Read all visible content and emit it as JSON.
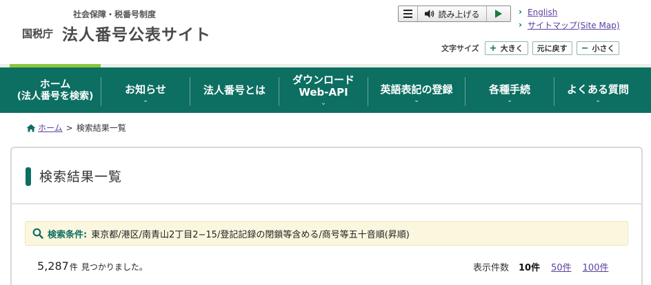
{
  "header": {
    "logo_sub": "社会保障・税番号制度",
    "logo_agency": "国税庁",
    "logo_main": "法人番号公表サイト",
    "readspeaker": {
      "read_label": "読み上げる",
      "menu_icon": "menu-icon",
      "speaker_icon": "speaker-icon",
      "play_icon": "play-icon"
    },
    "links": [
      {
        "label": "English"
      },
      {
        "label": "サイトマップ(Site Map)"
      }
    ],
    "font_size": {
      "label": "文字サイズ",
      "larger": "大きく",
      "larger_mark": "+",
      "reset": "元に戻す",
      "smaller": "小さく",
      "smaller_mark": "−"
    }
  },
  "nav": [
    {
      "line1": "ホーム",
      "line2": "(法人番号を検索)",
      "chevron": false
    },
    {
      "line1": "お知らせ",
      "line2": "",
      "chevron": true
    },
    {
      "line1": "法人番号とは",
      "line2": "",
      "chevron": false
    },
    {
      "line1": "ダウンロード",
      "line2": "Web-API",
      "chevron": true
    },
    {
      "line1": "英語表記の登録",
      "line2": "",
      "chevron": true
    },
    {
      "line1": "各種手続",
      "line2": "",
      "chevron": true
    },
    {
      "line1": "よくある質問",
      "line2": "",
      "chevron": true
    }
  ],
  "breadcrumb": {
    "home": "ホーム",
    "separator": ">",
    "current": "検索結果一覧"
  },
  "main": {
    "title": "検索結果一覧",
    "search_condition_label": "検索条件:",
    "search_condition_value": "東京都/港区/南青山2丁目2−15/登記記録の閉鎖等含める/商号等五十音順(昇順)",
    "result_count": "5,287",
    "result_unit": "件",
    "result_message": "見つかりました。",
    "per_page_label": "表示件数",
    "per_page_current": "10件",
    "per_page_options": [
      "50件",
      "100件"
    ]
  },
  "colors": {
    "nav_bg": "#0d6e62",
    "accent_green": "#8cc63f",
    "link_purple": "#5a3fa0",
    "condition_bg": "#fbf7df"
  }
}
